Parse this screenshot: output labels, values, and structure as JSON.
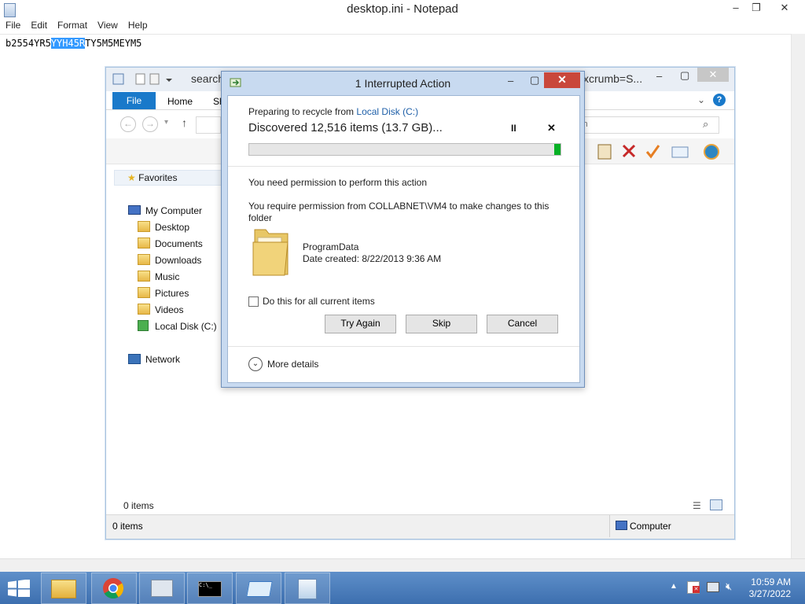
{
  "notepad": {
    "title": "desktop.ini - Notepad",
    "menu": [
      "File",
      "Edit",
      "Format",
      "View",
      "Help"
    ],
    "text_before": "b2554YR5",
    "text_selected": "YYH45R",
    "text_after": "TY5M5MEYM5",
    "min": "–",
    "max": "❐",
    "close": "✕"
  },
  "explorer": {
    "address_partial": "search",
    "address_right": "xcrumb=S...",
    "ribbon": {
      "file": "File",
      "home": "Home",
      "share": "Sh"
    },
    "search_partial": "ch",
    "nav": {
      "favorites": "Favorites",
      "my_computer": "My Computer",
      "items": [
        "Desktop",
        "Documents",
        "Downloads",
        "Music",
        "Pictures",
        "Videos",
        "Local Disk (C:)"
      ],
      "network": "Network"
    },
    "status_items": "0 items",
    "status_bar_items": "0 items",
    "status_bar_location": "Computer"
  },
  "dialog": {
    "title": "1 Interrupted Action",
    "preparing": "Preparing to recycle from",
    "source": "Local Disk (C:)",
    "discovered": "Discovered 12,516 items (13.7 GB)...",
    "progress": 0.02,
    "pause": "II",
    "stop": "✕",
    "permission_heading": "You need permission to perform this action",
    "permission_msg_1": "You require permission from COLLABNET\\VM4 to make changes to this",
    "permission_msg_2": "folder",
    "folder_name": "ProgramData",
    "date_created": "Date created: 8/22/2013 9:36 AM",
    "checkbox_label": "Do this for all current items",
    "buttons": {
      "try_again": "Try Again",
      "skip": "Skip",
      "cancel": "Cancel"
    },
    "more_details": "More details",
    "min": "–",
    "max": "▢",
    "close": "✕"
  },
  "taskbar": {
    "time": "10:59 AM",
    "date": "3/27/2022",
    "cmd_label": "C:\\_"
  },
  "colors": {
    "accent": "#1979ca",
    "progress": "#06b025",
    "link": "#1e5fa8",
    "close_red": "#c9473b"
  }
}
